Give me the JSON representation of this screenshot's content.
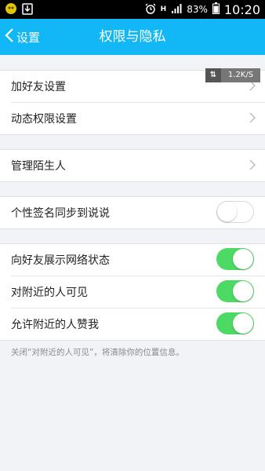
{
  "status_bar": {
    "battery": "83%",
    "time": "10:20",
    "network": "H"
  },
  "nav": {
    "back_label": "设置",
    "title": "权限与隐私"
  },
  "speed_overlay": {
    "value": "1.2K/S"
  },
  "groups": {
    "g1": [
      "加好友设置",
      "动态权限设置"
    ],
    "g2": [
      "管理陌生人"
    ],
    "g3": [
      "个性签名同步到说说"
    ],
    "g4": [
      "向好友展示网络状态",
      "对附近的人可见",
      "允许附近的人赞我"
    ]
  },
  "toggles": {
    "signature_sync": false,
    "show_network_status": true,
    "visible_to_nearby": true,
    "allow_nearby_like": true
  },
  "footnote": "关闭“对附近的人可见”，将清除你的位置信息。",
  "colors": {
    "nav_bg": "#12b7f5",
    "toggle_on": "#4cd964",
    "page_bg": "#f2f3f7"
  }
}
